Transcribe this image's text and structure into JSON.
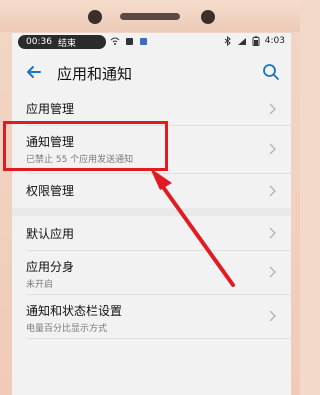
{
  "status": {
    "time_left": "00:36",
    "end_label": "结束",
    "time_right": "4:03"
  },
  "appbar": {
    "title": "应用和通知"
  },
  "items": [
    {
      "label": "应用管理",
      "sub": ""
    },
    {
      "label": "通知管理",
      "sub": "已禁止 55 个应用发送通知"
    },
    {
      "label": "权限管理",
      "sub": ""
    },
    {
      "label": "默认应用",
      "sub": ""
    },
    {
      "label": "应用分身",
      "sub": "未开启"
    },
    {
      "label": "通知和状态栏设置",
      "sub": "电量百分比显示方式"
    }
  ],
  "colors": {
    "accent": "#1a73c7",
    "highlight": "#e21b23"
  },
  "icons": {
    "back": "arrow-left-icon",
    "search": "search-icon",
    "chevron": "chevron-right-icon"
  }
}
